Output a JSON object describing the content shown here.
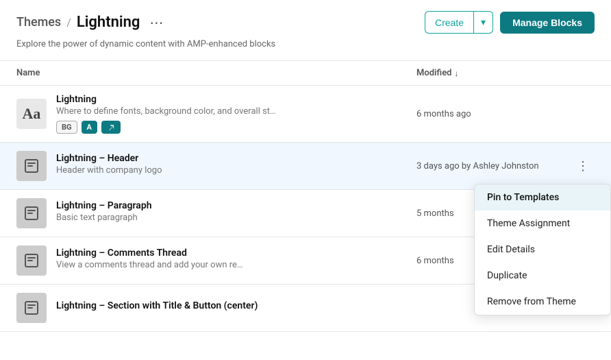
{
  "breadcrumb": {
    "themes_label": "Themes",
    "separator": "/",
    "current": "Lightning",
    "more_icon": "⋯"
  },
  "header": {
    "subtitle": "Explore the power of dynamic content with AMP-enhanced blocks",
    "create_label": "Create",
    "create_dropdown_icon": "▾",
    "manage_blocks_label": "Manage Blocks"
  },
  "table": {
    "col_name": "Name",
    "col_modified": "Modified",
    "sort_arrow": "↓"
  },
  "rows": [
    {
      "id": "lightning",
      "icon_type": "text",
      "icon_text": "Aa",
      "title": "Lightning",
      "desc": "Where to define fonts, background color, and overall st…",
      "tags": [
        {
          "label": "BG",
          "type": "bg"
        },
        {
          "label": "A",
          "type": "a"
        },
        {
          "label": "🔗",
          "type": "link"
        }
      ],
      "modified": "6 months ago",
      "has_menu": false
    },
    {
      "id": "lightning-header",
      "icon_type": "block",
      "icon_text": "□",
      "title": "Lightning – Header",
      "desc": "Header with company logo",
      "tags": [],
      "modified": "3 days ago by Ashley Johnston",
      "has_menu": true
    },
    {
      "id": "lightning-paragraph",
      "icon_type": "block",
      "icon_text": "□",
      "title": "Lightning – Paragraph",
      "desc": "Basic text paragraph",
      "tags": [],
      "modified": "5 months",
      "has_menu": false
    },
    {
      "id": "lightning-comments",
      "icon_type": "block",
      "icon_text": "□",
      "title": "Lightning – Comments Thread",
      "desc": "View a comments thread and add your own re…",
      "tags": [],
      "modified": "6 months",
      "has_menu": false
    },
    {
      "id": "lightning-section",
      "icon_type": "block",
      "icon_text": "□",
      "title": "Lightning – Section with Title & Button (center)",
      "desc": "",
      "tags": [],
      "modified": "",
      "has_menu": false
    }
  ],
  "dropdown_menu": {
    "items": [
      {
        "id": "pin-templates",
        "label": "Pin to Templates",
        "active": true
      },
      {
        "id": "theme-assignment",
        "label": "Theme Assignment",
        "active": false
      },
      {
        "id": "edit-details",
        "label": "Edit Details",
        "active": false
      },
      {
        "id": "duplicate",
        "label": "Duplicate",
        "active": false
      },
      {
        "id": "remove-from-theme",
        "label": "Remove from Theme",
        "active": false
      }
    ]
  }
}
